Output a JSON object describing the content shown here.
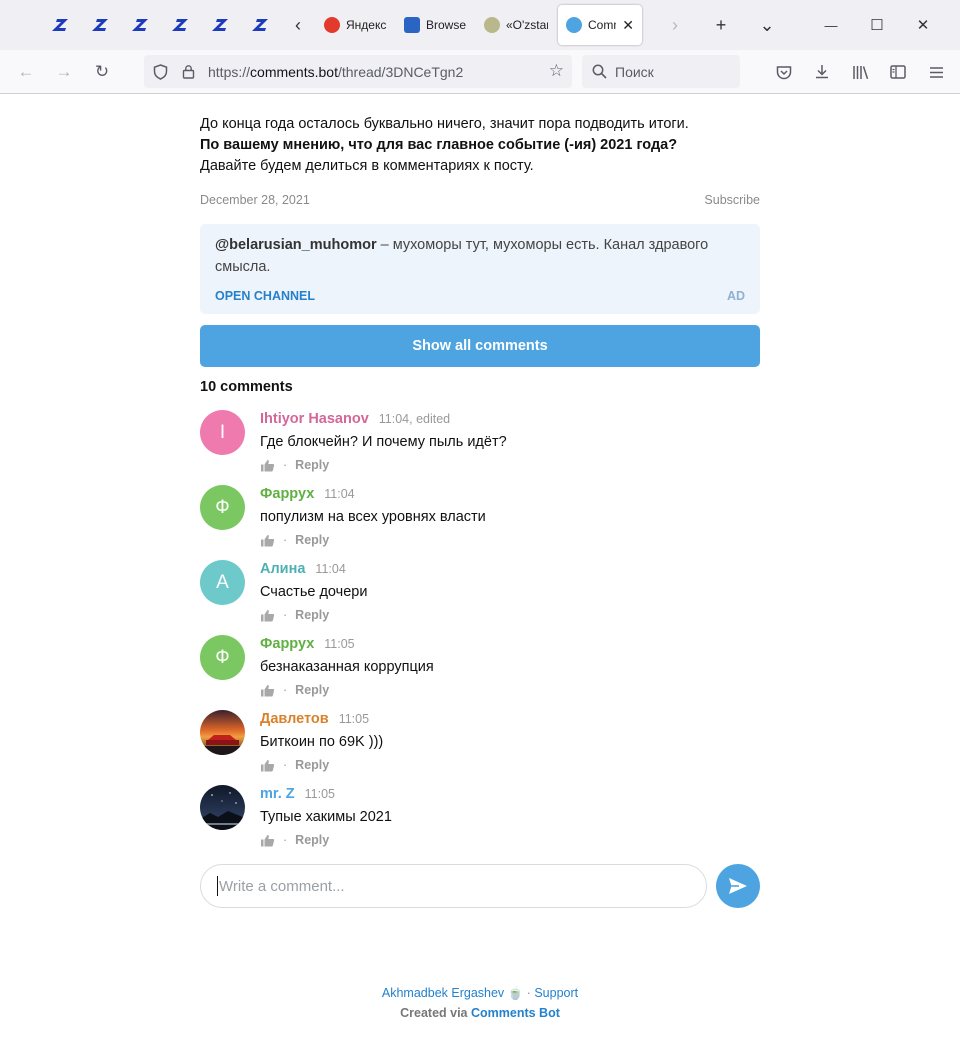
{
  "browser": {
    "pinned_tabs": [
      "pin1",
      "pin2",
      "pin3",
      "pin4",
      "pin5",
      "pin6"
    ],
    "tabs": [
      {
        "title": "Яндекс",
        "color": "#e23b2e"
      },
      {
        "title": "Browse",
        "color": "#2b65c4"
      },
      {
        "title": "«O'zstar",
        "color": "#9a9a6a"
      },
      {
        "title": "Comments",
        "color": "#4ea4e0",
        "active": true
      }
    ],
    "tab_scroll_left_icon": "‹",
    "tab_scroll_right_icon": "›",
    "new_tab_icon": "+",
    "tabs_list_icon": "⌄",
    "window_controls": {
      "minimize": "—",
      "maximize": "☐",
      "close": "✕"
    },
    "url_prefix": "https://",
    "url_host": "comments.bot",
    "url_path": "/thread/3DNCeTgn2",
    "search_placeholder": "Поиск"
  },
  "post": {
    "line1": "До конца года осталось буквально ничего, значит пора подводить итоги.",
    "line2": "По вашему мнению, что для вас главное событие (-ия) 2021 года?",
    "line3": "Давайте будем делиться в комментариях к посту.",
    "date": "December 28, 2021",
    "subscribe": "Subscribe"
  },
  "ad": {
    "handle": "@belarusian_muhomor",
    "text": " – мухоморы тут, мухоморы есть. Канал здравого смысла.",
    "open_label": "OPEN CHANNEL",
    "ad_label": "AD"
  },
  "show_all_label": "Show all comments",
  "comment_count": "10 comments",
  "comments": [
    {
      "initial": "I",
      "avatar_color": "#ee7aae",
      "name": "Ihtiyor Hasanov",
      "name_color": "#d4679a",
      "time": "11:04, edited",
      "text": "Где блокчейн? И почему пыль идёт?",
      "reply": "Reply"
    },
    {
      "initial": "Ф",
      "avatar_color": "#7bc862",
      "name": "Фаррух",
      "name_color": "#5fb043",
      "time": "11:04",
      "text": "популизм на всех уровнях власти",
      "reply": "Reply"
    },
    {
      "initial": "А",
      "avatar_color": "#6ec9cb",
      "name": "Алина",
      "name_color": "#4eb0b3",
      "time": "11:04",
      "text": "Счастье дочери",
      "reply": "Reply"
    },
    {
      "initial": "Ф",
      "avatar_color": "#7bc862",
      "name": "Фаррух",
      "name_color": "#5fb043",
      "time": "11:05",
      "text": "безнаказанная коррупция",
      "reply": "Reply"
    },
    {
      "initial": "",
      "avatar_color": "#c2562a",
      "name": "Давлетов",
      "name_color": "#d9822b",
      "time": "11:05",
      "text": "Биткоин по 69K )))",
      "reply": "Reply"
    },
    {
      "initial": "",
      "avatar_color": "#1b2436",
      "name": "mr. Z",
      "name_color": "#4ea4e0",
      "time": "11:05",
      "text": "Тупые хакимы 2021",
      "reply": "Reply"
    }
  ],
  "composer": {
    "placeholder": "Write a comment..."
  },
  "footer": {
    "author": "Akhmadbek Ergashev 🍵",
    "separator": " · ",
    "support": "Support",
    "created_via": "Created via ",
    "bot_link": "Comments Bot"
  }
}
